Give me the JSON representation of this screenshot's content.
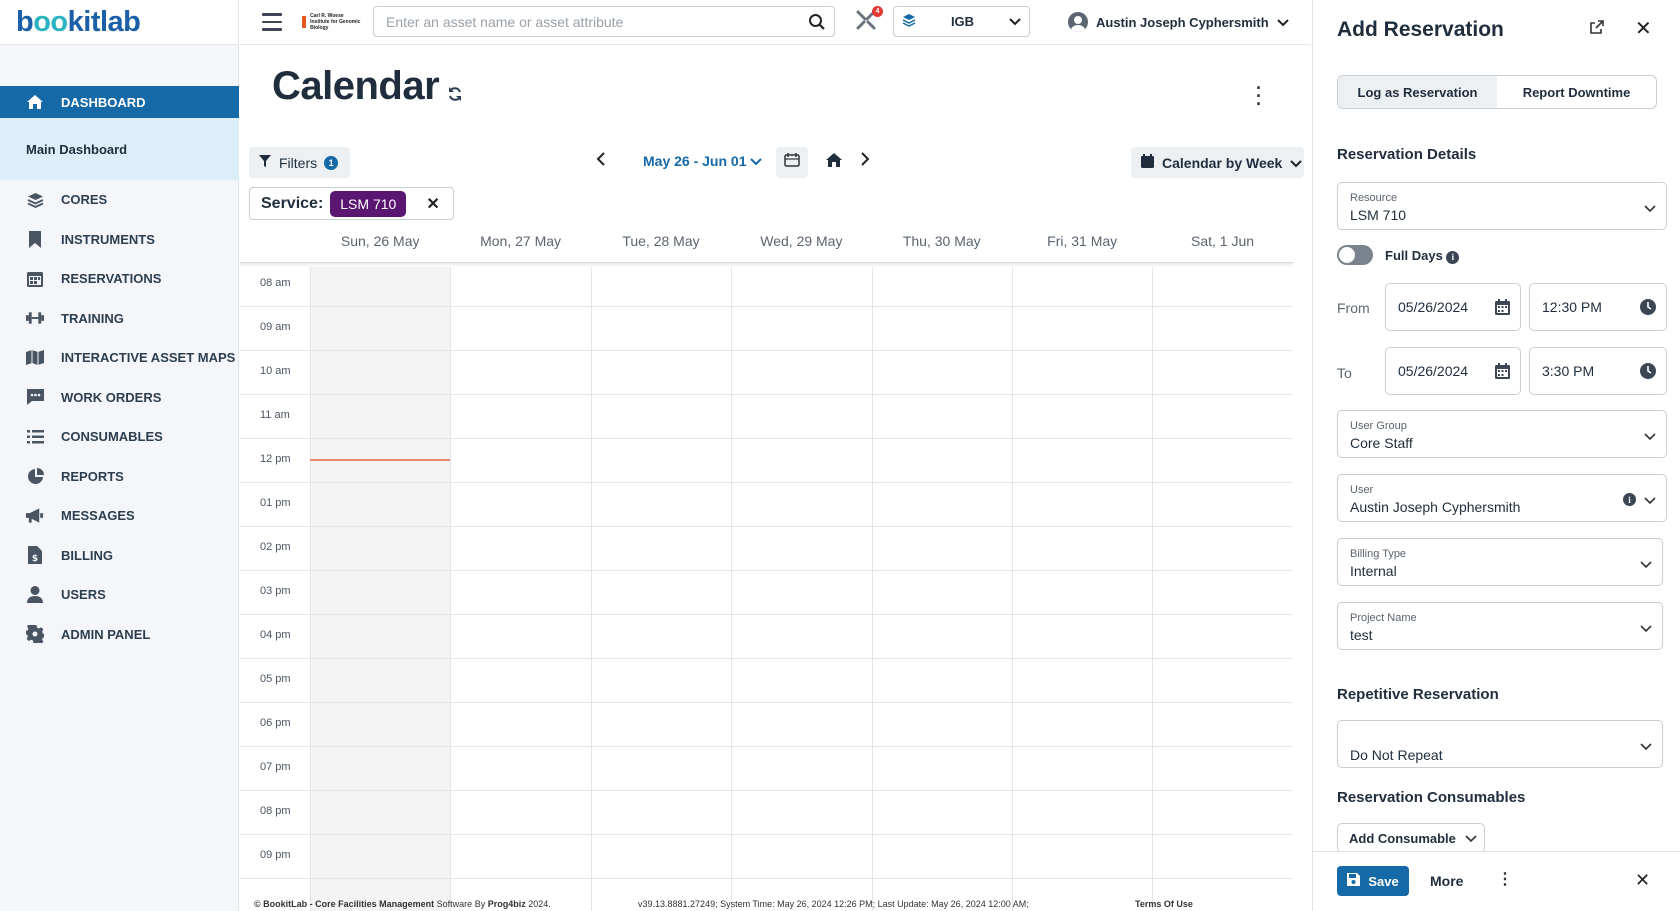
{
  "app": {
    "logo_prefix": "b",
    "logo_o": "oo",
    "logo_suffix": "kitlab"
  },
  "sidebar": {
    "dashboard": "DASHBOARD",
    "main_dashboard": "Main Dashboard",
    "items": [
      {
        "label": "CORES",
        "icon": "layers-icon"
      },
      {
        "label": "INSTRUMENTS",
        "icon": "bookmark-icon"
      },
      {
        "label": "RESERVATIONS",
        "icon": "calendar-icon"
      },
      {
        "label": "TRAINING",
        "icon": "dumbbell-icon"
      },
      {
        "label": "INTERACTIVE ASSET MAPS",
        "icon": "map-icon"
      },
      {
        "label": "WORK ORDERS",
        "icon": "comment-icon"
      },
      {
        "label": "CONSUMABLES",
        "icon": "list-icon"
      },
      {
        "label": "REPORTS",
        "icon": "pie-chart-icon"
      },
      {
        "label": "MESSAGES",
        "icon": "megaphone-icon"
      },
      {
        "label": "BILLING",
        "icon": "invoice-icon"
      },
      {
        "label": "USERS",
        "icon": "user-icon"
      },
      {
        "label": "ADMIN PANEL",
        "icon": "gear-icon"
      }
    ]
  },
  "topbar": {
    "search_placeholder": "Enter an asset name or asset attribute",
    "tools_badge": "4",
    "core_select": "IGB",
    "user_name": "Austin Joseph Cyphersmith",
    "institution_text": "Carl R. Woese Institute for Genomic Biology"
  },
  "calendar": {
    "title": "Calendar",
    "filters_label": "Filters",
    "filters_count": "1",
    "service_label": "Service:",
    "service_value": "LSM 710",
    "date_range": "May 26 - Jun 01",
    "view_label": "Calendar by Week",
    "days": [
      "Sun, 26 May",
      "Mon, 27 May",
      "Tue, 28 May",
      "Wed, 29 May",
      "Thu, 30 May",
      "Fri, 31 May",
      "Sat, 1 Jun"
    ],
    "hours": [
      "08 am",
      "09 am",
      "10 am",
      "11 am",
      "12 pm",
      "01 pm",
      "02 pm",
      "03 pm",
      "04 pm",
      "05 pm",
      "06 pm",
      "07 pm",
      "08 pm",
      "09 pm"
    ]
  },
  "footer": {
    "copyright": "© BookitLab - Core Facilities Management",
    "software_by": " Software By ",
    "company": "Prog4biz",
    "year": " 2024.",
    "version": "v39.13.8881.27249; System Time: May 26, 2024 12:26 PM; Last Update: May 26, 2024 12:00 AM;",
    "terms": "Terms Of Use"
  },
  "panel": {
    "title": "Add Reservation",
    "tab_log": "Log as Reservation",
    "tab_downtime": "Report Downtime",
    "details_heading": "Reservation Details",
    "resource_label": "Resource",
    "resource_value": "LSM 710",
    "full_days": "Full Days",
    "from_label": "From",
    "from_date": "05/26/2024",
    "from_time": "12:30 PM",
    "to_label": "To",
    "to_date": "05/26/2024",
    "to_time": "3:30 PM",
    "user_group_label": "User Group",
    "user_group_value": "Core Staff",
    "user_label": "User",
    "user_value": "Austin Joseph Cyphersmith",
    "billing_label": "Billing Type",
    "billing_value": "Internal",
    "project_label": "Project Name",
    "project_value": "test",
    "repetitive_heading": "Repetitive Reservation",
    "repeat_value": "Do Not Repeat",
    "consumables_heading": "Reservation Consumables",
    "add_consumable": "Add Consumable",
    "save": "Save",
    "more": "More"
  }
}
